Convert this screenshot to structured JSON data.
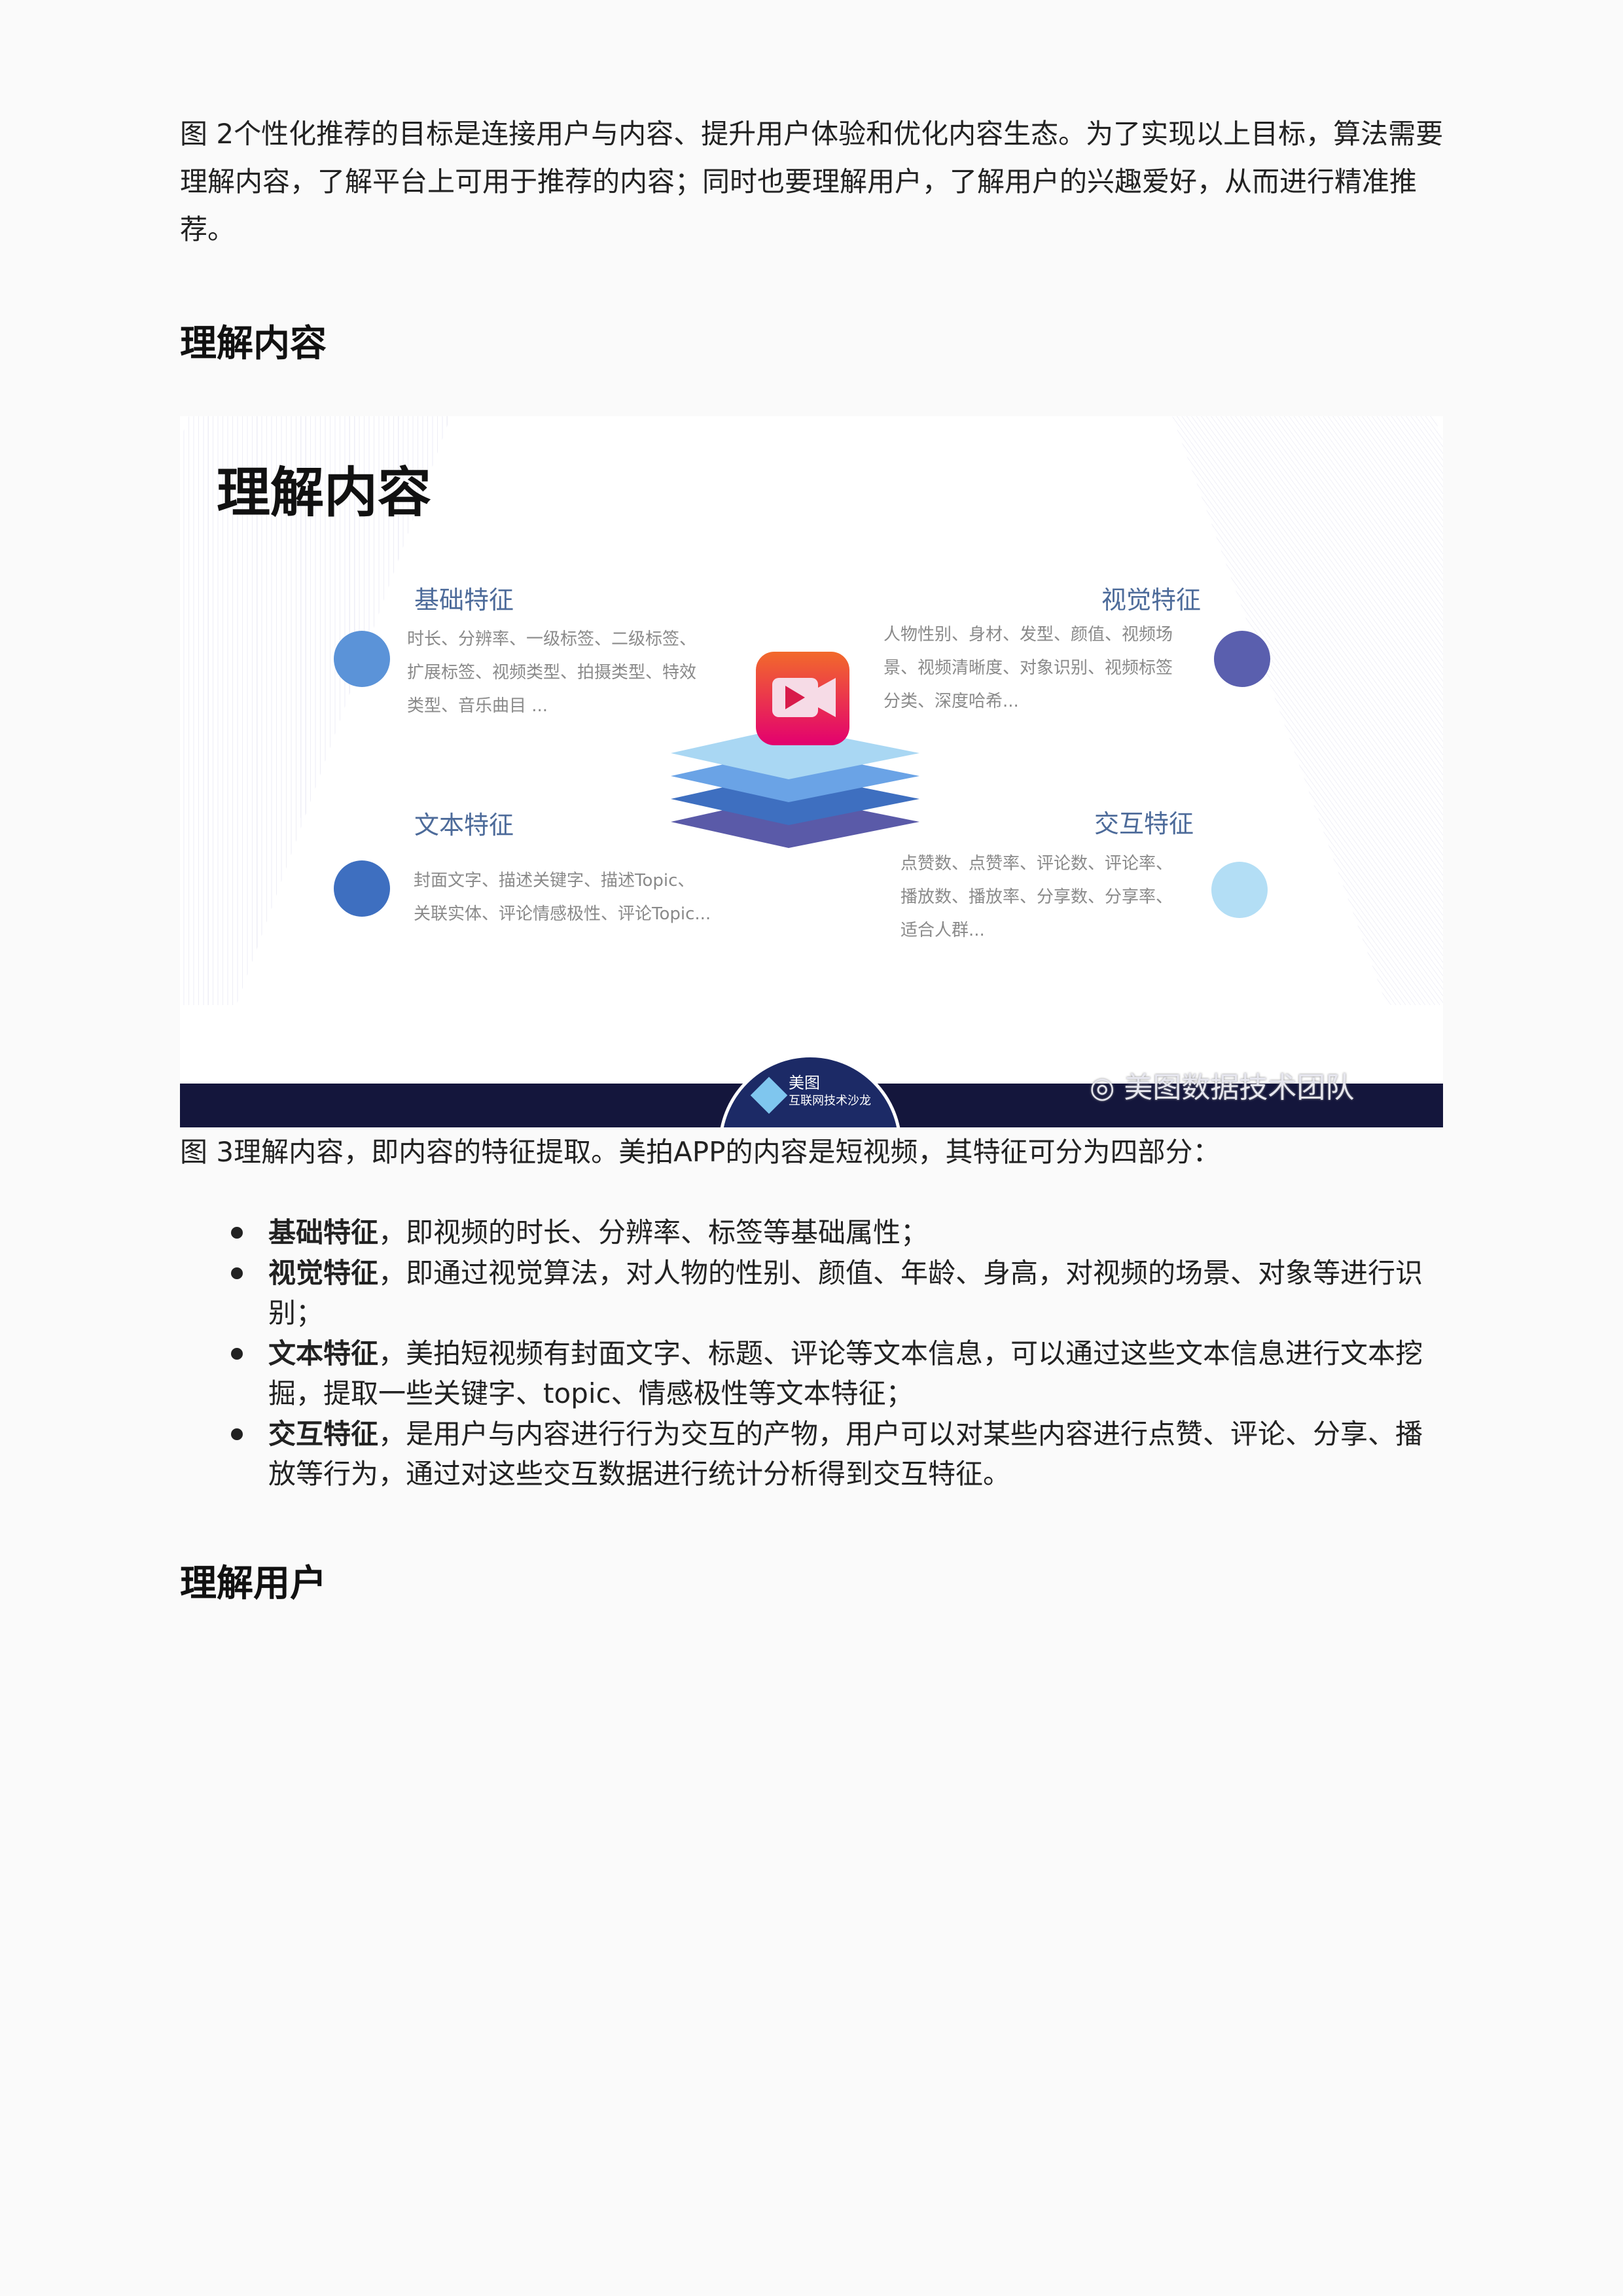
{
  "intro_paragraph": "图 2个性化推荐的目标是连接用户与内容、提升用户体验和优化内容生态。为了实现以上目标，算法需要理解内容，了解平台上可用于推荐的内容；同时也要理解用户，了解用户的兴趣爱好，从而进行精准推荐。",
  "heading_content": "理解内容",
  "figure": {
    "title": "理解内容",
    "basic": {
      "label": "基础特征",
      "lines": [
        "时长、分辨率、一级标签、二级标签、",
        "扩展标签、视频类型、拍摄类型、特效",
        "类型、音乐曲目 ..."
      ],
      "color": "#5b93d8"
    },
    "visual": {
      "label": "视觉特征",
      "lines": [
        "人物性别、身材、发型、颜值、视频场",
        "景、视频清晰度、对象识别、视频标签",
        "分类、深度哈希..."
      ],
      "color": "#5a5fae"
    },
    "text": {
      "label": "文本特征",
      "lines": [
        "封面文字、描述关键字、描述Topic、",
        "关联实体、评论情感极性、评论Topic..."
      ],
      "color": "#3e6fc0"
    },
    "interaction": {
      "label": "交互特征",
      "lines": [
        "点赞数、点赞率、评论数、评论率、",
        "播放数、播放率、分享数、分享率、",
        "适合人群..."
      ],
      "color": "#b3def5"
    },
    "logo_text": [
      "美图",
      "互联网技术沙龙"
    ],
    "watermark": "美图数据技术团队",
    "icon": "video-camera-app-icon"
  },
  "caption": "图 3理解内容，即内容的特征提取。美拍APP的内容是短视频，其特征可分为四部分：",
  "bullets": [
    {
      "term": "基础特征",
      "text": "，即视频的时长、分辨率、标签等基础属性；"
    },
    {
      "term": "视觉特征",
      "text": "，即通过视觉算法，对人物的性别、颜值、年龄、身高，对视频的场景、对象等进行识别；"
    },
    {
      "term": "文本特征",
      "text": "，美拍短视频有封面文字、标题、评论等文本信息，可以通过这些文本信息进行文本挖掘，提取一些关键字、topic、情感极性等文本特征；"
    },
    {
      "term": "交互特征",
      "text": "，是用户与内容进行行为交互的产物，用户可以对某些内容进行点赞、评论、分享、播放等行为，通过对这些交互数据进行统计分析得到交互特征。"
    }
  ],
  "heading_user": "理解用户"
}
